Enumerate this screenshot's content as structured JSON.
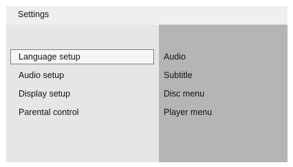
{
  "header": {
    "title": "Settings"
  },
  "menu": {
    "items": [
      {
        "label": "Language setup",
        "selected": true
      },
      {
        "label": "Audio setup",
        "selected": false
      },
      {
        "label": "Display setup",
        "selected": false
      },
      {
        "label": "Parental control",
        "selected": false
      }
    ]
  },
  "submenu": {
    "items": [
      {
        "label": "Audio"
      },
      {
        "label": "Subtitle"
      },
      {
        "label": "Disc menu"
      },
      {
        "label": "Player menu"
      }
    ]
  }
}
